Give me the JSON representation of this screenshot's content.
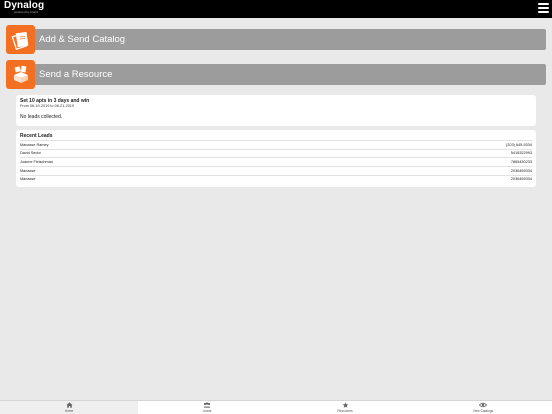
{
  "header": {
    "brand": "Dynalog",
    "brand_tagline": "powered by brand"
  },
  "actions": [
    {
      "label": "Add & Send Catalog",
      "icon": "catalog-icon"
    },
    {
      "label": "Send a Resource",
      "icon": "resource-box-icon"
    }
  ],
  "goal": {
    "title": "Set 10 apts in 3 days and win",
    "range": "From 06-19-2019 to 06-21-2019",
    "empty_text": "No leads collected."
  },
  "recent_leads": {
    "title": "Recent Leads",
    "rows": [
      {
        "name": "Manasse Ramey",
        "phone": "(203) 645-9334"
      },
      {
        "name": "David Sedor",
        "phone": "5418322993"
      },
      {
        "name": "Joanne Fleischman",
        "phone": "7865430233"
      },
      {
        "name": "Manasse",
        "phone": "2036459334"
      },
      {
        "name": "Manasse",
        "phone": "2036459334"
      }
    ]
  },
  "tabs": [
    {
      "label": "Home",
      "icon": "home-icon"
    },
    {
      "label": "Leads",
      "icon": "leads-icon"
    },
    {
      "label": "Resources",
      "icon": "resources-icon"
    },
    {
      "label": "View Catalogs",
      "icon": "eye-icon"
    }
  ],
  "colors": {
    "accent": "#f36f21",
    "action_bar": "#9c9c9c",
    "topbar": "#000000",
    "background": "#e9e9e9"
  }
}
